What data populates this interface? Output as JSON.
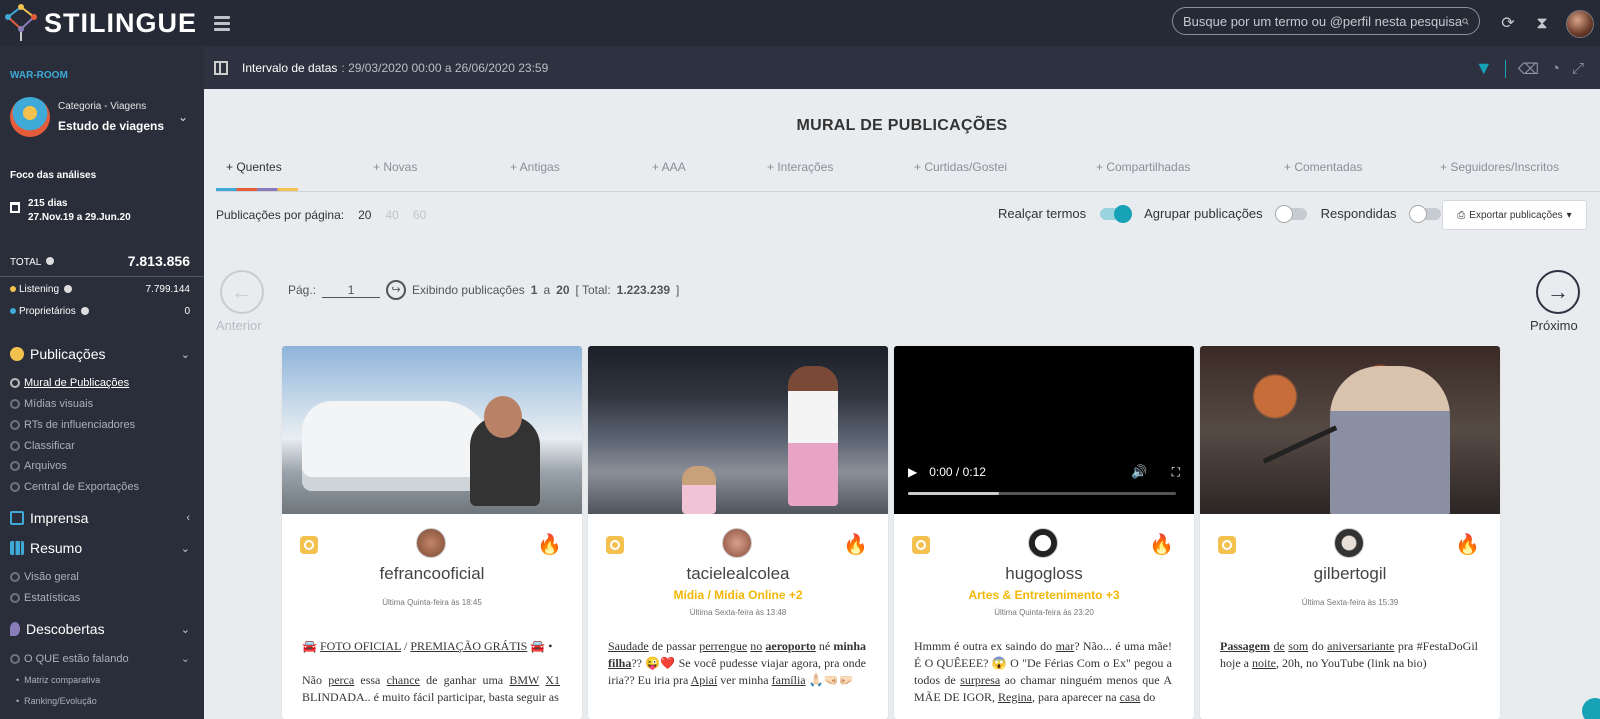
{
  "brand": {
    "name": "STILINGUE"
  },
  "search": {
    "placeholder": "Busque por um termo ou @perfil nesta pesquisa"
  },
  "sidebar": {
    "war_room": "WAR-ROOM",
    "category_sub": "Categoria - Viagens",
    "category_main": "Estudo de viagens",
    "focus_title": "Foco das análises",
    "focus_days": "215 dias",
    "focus_range": "27.Nov.19 a 29.Jun.20",
    "total_label": "TOTAL",
    "total_value": "7.813.856",
    "sources": [
      {
        "label": "Listening",
        "value": "7.799.144",
        "color": "#f2c14e"
      },
      {
        "label": "Proprietários",
        "value": "0",
        "color": "#3fa9d8"
      }
    ],
    "sections": {
      "publicacoes": "Publicações",
      "imprensa": "Imprensa",
      "resumo": "Resumo",
      "descobertas": "Descobertas"
    },
    "publicacoes_items": [
      "Mural de Publicações",
      "Mídias visuais",
      "RTs de influenciadores",
      "Classificar",
      "Arquivos",
      "Central de Exportações"
    ],
    "resumo_items": [
      "Visão geral",
      "Estatísticas"
    ],
    "descobertas_items": [
      "O QUE estão falando"
    ],
    "descobertas_sub": [
      "Matriz comparativa",
      "Ranking/Evolução"
    ]
  },
  "datebar": {
    "label": "Intervalo de datas",
    "value": ": 29/03/2020 00:00 a 26/06/2020 23:59"
  },
  "main": {
    "title": "MURAL DE PUBLICAÇÕES",
    "tabs": [
      "+ Quentes",
      "+ Novas",
      "+ Antigas",
      "+ AAA",
      "+ Interações",
      "+ Curtidas/Gostei",
      "+ Compartilhadas",
      "+ Comentadas",
      "+ Seguidores/Inscritos"
    ],
    "per_page_label": "Publicações por página:",
    "per_page_options": [
      "20",
      "40",
      "60"
    ],
    "toggles": {
      "realcar": "Realçar termos",
      "agrupar": "Agrupar publicações",
      "respondidas": "Respondidas"
    },
    "export_label": "Exportar publicações",
    "pager": {
      "prev": "Anterior",
      "next": "Próximo",
      "page_label": "Pág.:",
      "page_value": "1",
      "showing": "Exibindo publicações",
      "from": "1",
      "a": "a",
      "to": "20",
      "total_prefix": "[ Total:",
      "total": "1.223.239",
      "total_suffix": "]"
    }
  },
  "cards": [
    {
      "name": "fefrancooficial",
      "category": "",
      "time": "Última Quinta-feira às 18:45"
    },
    {
      "name": "tacielealcolea",
      "category": "Mídia / Mídia Online +2",
      "time": "Última Sexta-feira às 13:48"
    },
    {
      "name": "hugogloss",
      "category": "Artes & Entretenimento +3",
      "time": "Última Quinta-feira às 23:20",
      "video_time": "0:00 / 0:12",
      "video_progress": 0.34
    },
    {
      "name": "gilbertogil",
      "category": "",
      "time": "Última Sexta-feira às 15:39"
    }
  ],
  "card_texts": {
    "c1": {
      "p1": "FOTO OFICIAL",
      "p2": " / ",
      "p3": "PREMIAÇÃO GRÁTIS",
      "line2a": "Não ",
      "perca": "perca",
      "line2b": " essa ",
      "chance": "chance",
      "line2c": " de ganhar uma ",
      "bmw": "BMW",
      "x1": "X1",
      "line3": "BLINDADA.. é muito fácil participar, basta seguir as"
    },
    "c2": {
      "saudade": "Saudade",
      "t1": " de passar ",
      "perrengue": "perrengue",
      "no": "no",
      "aeroporto": "aeroporto",
      "t2": " né ",
      "minha": "minha",
      "filha": "filha",
      "t3": "?? 😜❤️ Se você pudesse viajar agora, pra onde iria?? Eu iria pra ",
      "apiai": "Apiaí",
      "t4": " ver minha ",
      "familia": "família",
      "t5": " 🙏🏻🤜🏻🤛🏻"
    },
    "c3": {
      "t1": "Hmmm é outra ex saindo do ",
      "mar": "mar",
      "t2": "? Não... é uma mãe! É O QUÊEEE? 😱 O \"De Férias Com o Ex\" pegou a todos de ",
      "surpresa": "surpresa",
      "t3": " ao chamar ninguém menos que A MÃE DE IGOR, ",
      "regina": "Regina",
      "t4": ", para aparecer na ",
      "casa": "casa",
      "t5": " do"
    },
    "c4": {
      "passagem": "Passagem",
      "de": "de",
      "som": "som",
      "t1": " do ",
      "aniv": "aniversariante",
      "t2": " pra #FestaDoGil hoje a ",
      "noite": "noite",
      "t3": ", 20h, no YouTube (link na bio)"
    }
  },
  "colors": {
    "accent": "#17a2b8",
    "topbar": "#262a36",
    "sidebar": "#2a2e3a",
    "fire": "#f08a24",
    "instagram": "#f2c14e",
    "category": "#f2b705"
  }
}
